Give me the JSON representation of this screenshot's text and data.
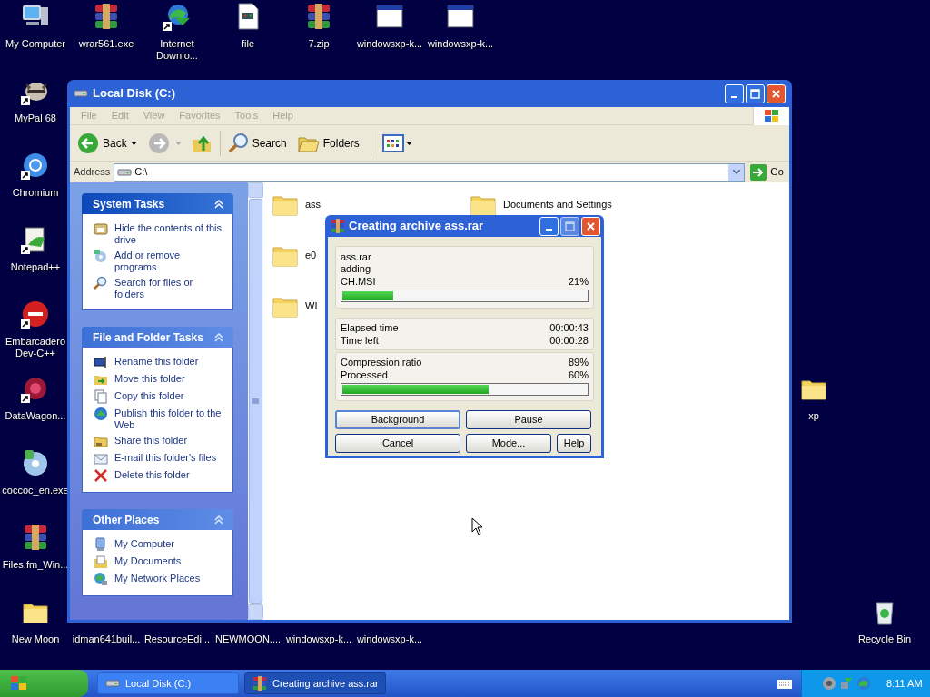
{
  "desktop": {
    "top_row": [
      {
        "label": "My Computer",
        "kind": "computer",
        "shortcut": false
      },
      {
        "label": "wrar561.exe",
        "kind": "rar",
        "shortcut": false
      },
      {
        "label": "Internet Downlo...",
        "kind": "idm",
        "shortcut": true
      },
      {
        "label": "file",
        "kind": "file",
        "shortcut": false
      },
      {
        "label": "7.zip",
        "kind": "rar",
        "shortcut": false
      },
      {
        "label": "windowsxp-k...",
        "kind": "window",
        "shortcut": false
      },
      {
        "label": "windowsxp-k...",
        "kind": "window",
        "shortcut": false
      }
    ],
    "left_column": [
      {
        "label": "MyPal 68",
        "kind": "raccoon",
        "shortcut": true
      },
      {
        "label": "Chromium",
        "kind": "chromium",
        "shortcut": true
      },
      {
        "label": "Notepad++",
        "kind": "notepad",
        "shortcut": true
      },
      {
        "label": "Embarcadero Dev-C++",
        "kind": "devcpp",
        "shortcut": true
      },
      {
        "label": "DataWagon...",
        "kind": "datawagon",
        "shortcut": true
      },
      {
        "label": "coccoc_en.exe",
        "kind": "coccoc",
        "shortcut": false
      },
      {
        "label": "Files.fm_Win...",
        "kind": "rar",
        "shortcut": false
      },
      {
        "label": "New Moon",
        "kind": "folder",
        "shortcut": false
      }
    ],
    "bottom_row": [
      "idman641buil...",
      "ResourceEdi...",
      "NEWMOON....",
      "windowsxp-k...",
      "windowsxp-k..."
    ],
    "right_column": [
      {
        "label": "xp",
        "kind": "folder",
        "shortcut": false
      },
      {
        "label": "Recycle Bin",
        "kind": "recycle",
        "shortcut": false
      }
    ]
  },
  "explorer": {
    "title": "Local Disk (C:)",
    "menu": [
      {
        "label": "File",
        "disabled": true
      },
      {
        "label": "Edit",
        "disabled": true
      },
      {
        "label": "View",
        "disabled": true
      },
      {
        "label": "Favorites",
        "disabled": true
      },
      {
        "label": "Tools",
        "disabled": true
      },
      {
        "label": "Help",
        "disabled": true
      }
    ],
    "toolbar": {
      "back": {
        "label": "Back",
        "disabled": false
      },
      "forward": {
        "disabled": true
      },
      "search": "Search",
      "folders": "Folders"
    },
    "address": {
      "label": "Address",
      "value": "C:\\",
      "go": "Go"
    },
    "task_panels": [
      {
        "title": "System Tasks",
        "special": true,
        "expanded": true,
        "items": [
          "Hide the contents of this drive",
          "Add or remove programs",
          "Search for files or folders"
        ]
      },
      {
        "title": "File and Folder Tasks",
        "special": false,
        "expanded": true,
        "items": [
          "Rename this folder",
          "Move this folder",
          "Copy this folder",
          "Publish this folder to the Web",
          "Share this folder",
          "E-mail this folder's files",
          "Delete this folder"
        ]
      },
      {
        "title": "Other Places",
        "special": false,
        "expanded": true,
        "items": [
          "My Computer",
          "My Documents",
          "My Network Places"
        ]
      }
    ],
    "files": [
      "ass",
      "e0",
      "WI",
      "Documents and Settings"
    ]
  },
  "archive_dialog": {
    "title": "Creating archive ass.rar",
    "archive": "ass.rar",
    "action": "adding",
    "file": "CH.MSI",
    "file_percent": "21%",
    "file_progress": {
      "level": 0.21
    },
    "times": [
      {
        "label": "Elapsed time",
        "value": "00:00:43"
      },
      {
        "label": "Time left",
        "value": "00:00:28"
      }
    ],
    "stats": [
      {
        "label": "Compression ratio",
        "value": "89%"
      },
      {
        "label": "Processed",
        "value": "60%"
      }
    ],
    "total_progress": {
      "level": 0.6
    },
    "buttons": [
      {
        "label": "Background",
        "selected": true
      },
      {
        "label": "Pause",
        "selected": false
      },
      {
        "label": "Cancel",
        "selected": false
      },
      {
        "label": "Mode...",
        "selected": false
      },
      {
        "label": "Help",
        "selected": false
      }
    ]
  },
  "taskbar": {
    "tasks": [
      {
        "label": "Local Disk (C:)",
        "selected": false
      },
      {
        "label": "Creating archive ass.rar",
        "selected": true
      }
    ],
    "clock": "8:11 AM"
  }
}
